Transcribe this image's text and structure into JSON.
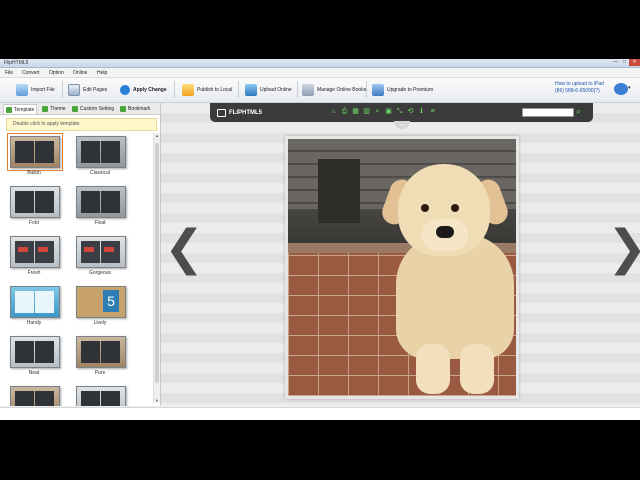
{
  "window": {
    "title": "FlipHTML5",
    "controls": {
      "minimize": "—",
      "maximize": "□",
      "close": "✕"
    }
  },
  "menu": [
    "File",
    "Convert",
    "Option",
    "Online",
    "Help"
  ],
  "toolbar": {
    "import": "Import File",
    "edit_pages": "Edit Pages",
    "apply": "Apply Change",
    "publish": "Publish to Local",
    "upload": "Upload Online",
    "manage": "Manage Online Books",
    "upgrade": "Upgrade to Premium"
  },
  "help": {
    "link": "How to upload to iPad",
    "phone": "(86) 588-6-65090(?)"
  },
  "left_panel": {
    "tabs": [
      "Template",
      "Theme",
      "Custom Setting",
      "Bookmark"
    ],
    "hint": "Double click to apply template.",
    "templates": [
      "Bulkin",
      "Classical",
      "Fold",
      "Float",
      "Fresh",
      "Gorgeous",
      "Handy",
      "Lively",
      "Neat",
      "Pure",
      "",
      ""
    ]
  },
  "viewer": {
    "brand": "FLIPHTML5",
    "tools": [
      "⌂",
      "⎙",
      "▦",
      "▥",
      "⌕",
      "▣",
      "⤡",
      "⟲",
      "ℹ",
      "≡"
    ],
    "search_icon": "⌕",
    "collapse_icon": "︿",
    "prev_icon": "❮",
    "next_icon": "❯"
  },
  "icons": {
    "import": "import-icon",
    "edit": "edit-pages-icon",
    "apply": "apply-change-icon",
    "publish": "publish-icon",
    "upload": "upload-icon",
    "manage": "manage-books-icon",
    "upgrade": "upgrade-icon",
    "user": "user-icon"
  },
  "colors": {
    "accent_green": "#6fdc63",
    "selected_outline": "#e57c2f",
    "topbar": "#3b3b3b"
  }
}
